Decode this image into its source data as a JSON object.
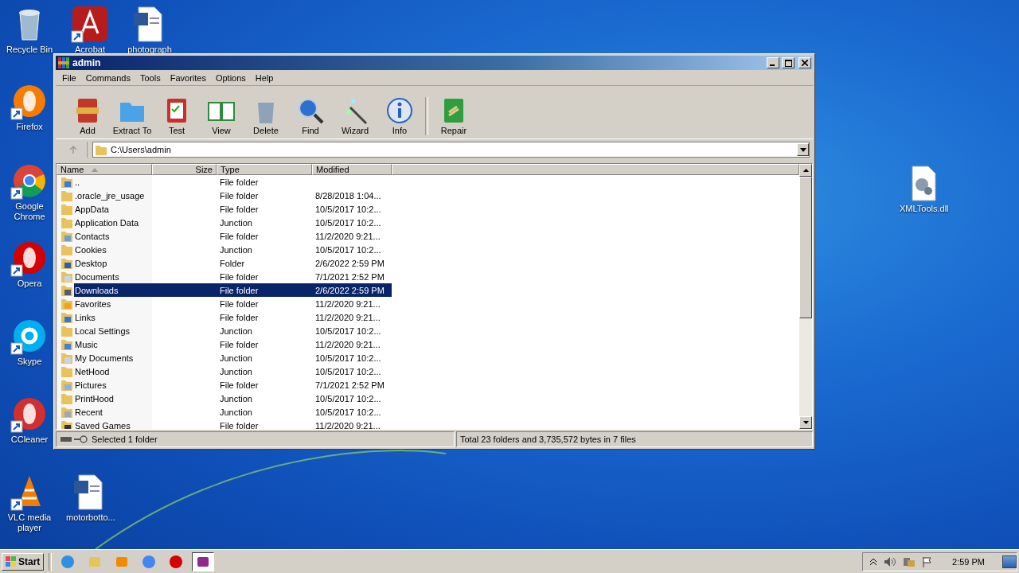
{
  "desktop_icons": [
    {
      "label": "Recycle Bin",
      "kind": "recycle",
      "shortcut": false
    },
    {
      "label": "Acrobat",
      "kind": "acrobat",
      "shortcut": true
    },
    {
      "label": "photograph",
      "kind": "word",
      "shortcut": false
    },
    {
      "label": "Firefox",
      "kind": "firefox",
      "shortcut": true
    },
    {
      "label": "Google Chrome",
      "kind": "chrome",
      "shortcut": true
    },
    {
      "label": "Opera",
      "kind": "opera",
      "shortcut": true
    },
    {
      "label": "Skype",
      "kind": "skype",
      "shortcut": true
    },
    {
      "label": "CCleaner",
      "kind": "ccleaner",
      "shortcut": true
    },
    {
      "label": "VLC media player",
      "kind": "vlc",
      "shortcut": true
    },
    {
      "label": "motorbotto...",
      "kind": "word",
      "shortcut": false
    },
    {
      "label": "XMLTools.dll",
      "kind": "dll",
      "shortcut": false
    }
  ],
  "window": {
    "title": "admin",
    "menu": [
      "File",
      "Commands",
      "Tools",
      "Favorites",
      "Options",
      "Help"
    ],
    "toolbar": [
      {
        "label": "Add",
        "kind": "add"
      },
      {
        "label": "Extract To",
        "kind": "extract"
      },
      {
        "label": "Test",
        "kind": "test"
      },
      {
        "label": "View",
        "kind": "view"
      },
      {
        "label": "Delete",
        "kind": "delete"
      },
      {
        "label": "Find",
        "kind": "find"
      },
      {
        "label": "Wizard",
        "kind": "wizard"
      },
      {
        "label": "Info",
        "kind": "info"
      },
      {
        "label": "Repair",
        "kind": "repair"
      }
    ],
    "address": "C:\\Users\\admin",
    "table": {
      "columns": [
        "Name",
        "Size",
        "Type",
        "Modified"
      ],
      "rows": [
        {
          "name": "..",
          "size": "",
          "type": "File folder",
          "modified": "",
          "kind": "up",
          "selected": false
        },
        {
          "name": ".oracle_jre_usage",
          "type": "File folder",
          "modified": "8/28/2018 1:04...",
          "kind": "folder",
          "selected": false
        },
        {
          "name": "AppData",
          "type": "File folder",
          "modified": "10/5/2017 10:2...",
          "kind": "folder",
          "selected": false
        },
        {
          "name": "Application Data",
          "type": "Junction",
          "modified": "10/5/2017 10:2...",
          "kind": "folder",
          "selected": false
        },
        {
          "name": "Contacts",
          "type": "File folder",
          "modified": "11/2/2020 9:21...",
          "kind": "contacts",
          "selected": false
        },
        {
          "name": "Cookies",
          "type": "Junction",
          "modified": "10/5/2017 10:2...",
          "kind": "folder",
          "selected": false
        },
        {
          "name": "Desktop",
          "type": "Folder",
          "modified": "2/6/2022 2:59 PM",
          "kind": "desktop",
          "selected": false
        },
        {
          "name": "Documents",
          "type": "File folder",
          "modified": "7/1/2021 2:52 PM",
          "kind": "documents",
          "selected": false
        },
        {
          "name": "Downloads",
          "type": "File folder",
          "modified": "2/6/2022 2:59 PM",
          "kind": "downloads",
          "selected": true
        },
        {
          "name": "Favorites",
          "type": "File folder",
          "modified": "11/2/2020 9:21...",
          "kind": "favorites",
          "selected": false
        },
        {
          "name": "Links",
          "type": "File folder",
          "modified": "11/2/2020 9:21...",
          "kind": "links",
          "selected": false
        },
        {
          "name": "Local Settings",
          "type": "Junction",
          "modified": "10/5/2017 10:2...",
          "kind": "folder",
          "selected": false
        },
        {
          "name": "Music",
          "type": "File folder",
          "modified": "11/2/2020 9:21...",
          "kind": "music",
          "selected": false
        },
        {
          "name": "My Documents",
          "type": "Junction",
          "modified": "10/5/2017 10:2...",
          "kind": "documents",
          "selected": false
        },
        {
          "name": "NetHood",
          "type": "Junction",
          "modified": "10/5/2017 10:2...",
          "kind": "folder",
          "selected": false
        },
        {
          "name": "Pictures",
          "type": "File folder",
          "modified": "7/1/2021 2:52 PM",
          "kind": "pictures",
          "selected": false
        },
        {
          "name": "PrintHood",
          "type": "Junction",
          "modified": "10/5/2017 10:2...",
          "kind": "folder",
          "selected": false
        },
        {
          "name": "Recent",
          "type": "Junction",
          "modified": "10/5/2017 10:2...",
          "kind": "recent",
          "selected": false
        },
        {
          "name": "Saved Games",
          "type": "File folder",
          "modified": "11/2/2020 9:21...",
          "kind": "games",
          "selected": false
        }
      ]
    },
    "status_bar": {
      "left": "Selected 1 folder",
      "right": "Total 23 folders and 3,735,572 bytes in 7 files"
    }
  },
  "taskbar": {
    "start": "Start",
    "apps": [
      {
        "kind": "ie",
        "selected": false
      },
      {
        "kind": "explorer",
        "selected": false
      },
      {
        "kind": "media",
        "selected": false
      },
      {
        "kind": "chrome",
        "selected": false
      },
      {
        "kind": "opera",
        "selected": false
      },
      {
        "kind": "winrar",
        "selected": true
      }
    ],
    "clock": "2:59 PM"
  }
}
